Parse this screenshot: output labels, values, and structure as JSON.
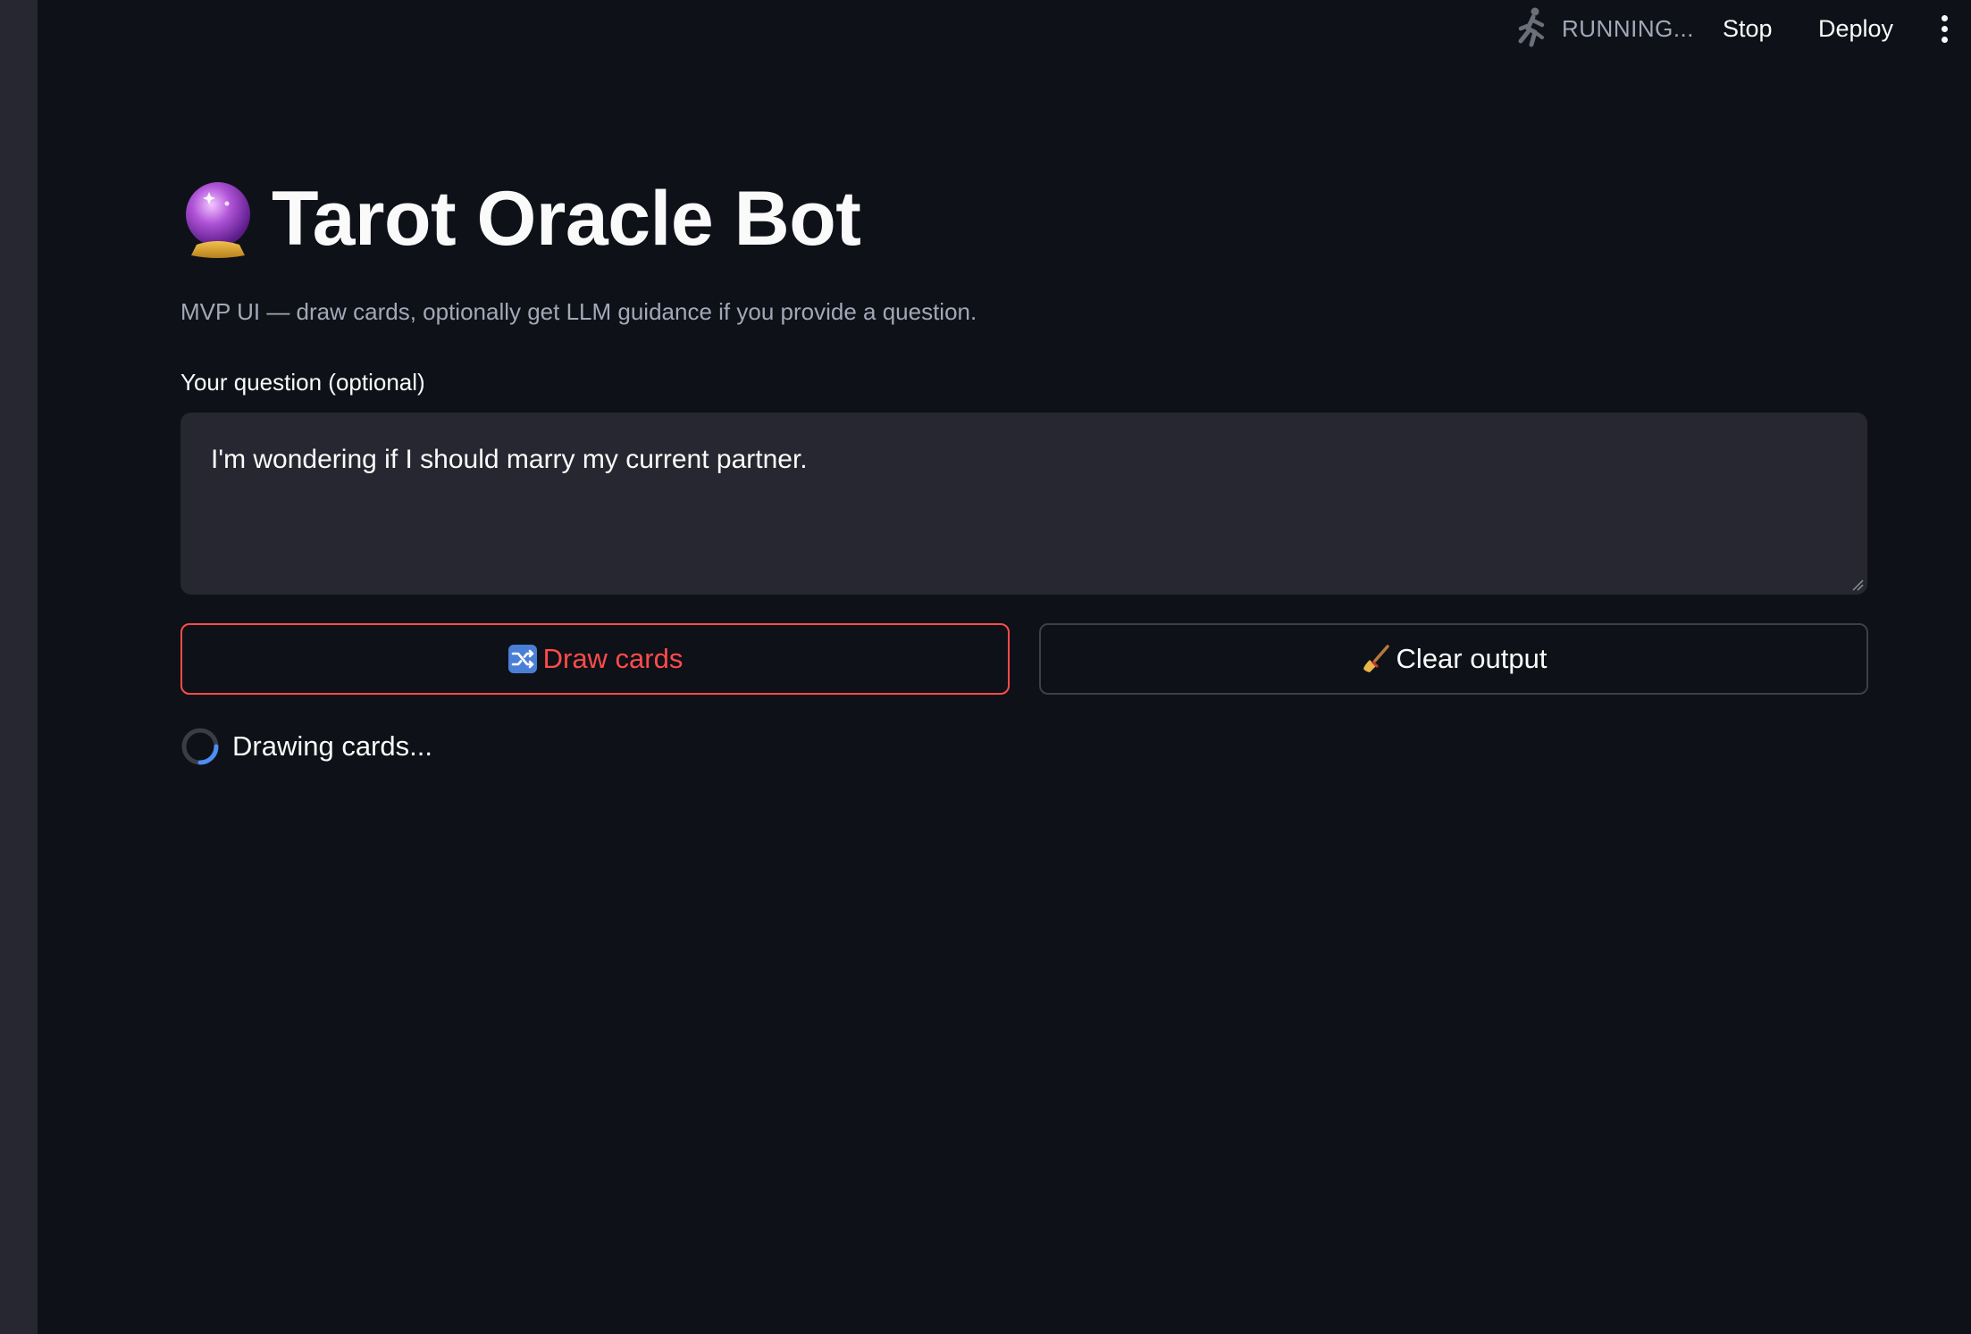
{
  "header": {
    "status_text": "RUNNING...",
    "stop_label": "Stop",
    "deploy_label": "Deploy",
    "status_icon": "running-person-icon",
    "menu_icon": "kebab-menu-icon"
  },
  "main": {
    "title_icon": "crystal-ball-icon",
    "title": "Tarot Oracle Bot",
    "subtitle": "MVP UI — draw cards, optionally get LLM guidance if you provide a question.",
    "question_label": "Your question (optional)",
    "question_value": "I'm wondering if I should marry my current partner.",
    "draw_button": {
      "icon": "shuffle-icon",
      "label": "Draw cards"
    },
    "clear_button": {
      "icon": "broom-icon",
      "label": "Clear output"
    },
    "spinner_text": "Drawing cards..."
  },
  "colors": {
    "background": "#0e1117",
    "sidebar": "#262730",
    "input_bg": "#262730",
    "accent": "#ff4b4b",
    "muted_text": "#a3a8b8",
    "spinner_accent": "#4c8df6"
  }
}
